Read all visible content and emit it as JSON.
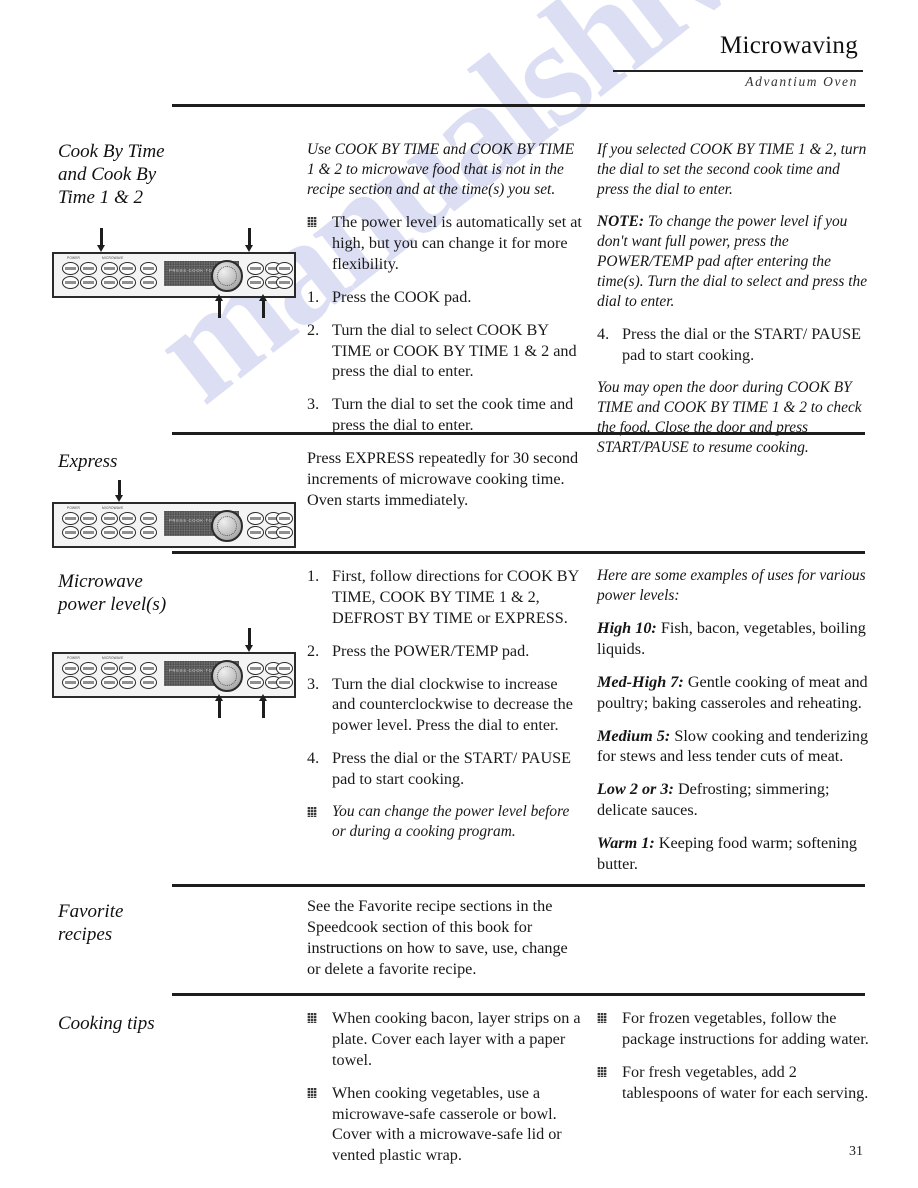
{
  "header": {
    "title": "Microwaving",
    "subtitle": "Advantium Oven"
  },
  "page_number": "31",
  "watermark": "manualshive.com",
  "panel_graphic": {
    "display_text": "PRESS COOK TO START",
    "group_label_left": "POWER",
    "group_label_right": "MICROWAVE"
  },
  "sections": [
    {
      "heading": "Cook By Time and Cook By Time 1 & 2",
      "middle": {
        "intro": "Use COOK BY TIME and COOK BY TIME 1 & 2 to microwave food that is not in the recipe section and at the time(s) you set.",
        "bullet": "The power level is automatically set at high, but you can change it for more flexibility.",
        "steps": [
          {
            "n": "1.",
            "text": "Press the COOK pad."
          },
          {
            "n": "2.",
            "text": "Turn the dial to select COOK BY TIME or COOK BY TIME 1 & 2 and press the dial to enter."
          },
          {
            "n": "3.",
            "text": "Turn the dial to set the cook time and press the dial to enter."
          }
        ]
      },
      "right": {
        "intro": "If you selected COOK BY TIME 1 & 2, turn the dial to set the second cook time and press the dial to enter.",
        "note_label": "NOTE:",
        "note_text": " To change the power level if you don't want full power, press the POWER/TEMP pad after entering the time(s). Turn the dial to select and press the dial to enter.",
        "steps": [
          {
            "n": "4.",
            "text": "Press the dial or the START/ PAUSE pad to start cooking."
          }
        ],
        "closing": "You may open the door during COOK BY TIME and COOK BY TIME 1 & 2 to check the food. Close the door and press START/PAUSE to resume cooking."
      }
    },
    {
      "heading": "Express",
      "middle": {
        "intro": "Press EXPRESS repeatedly for 30 second increments of microwave cooking time. Oven starts immediately."
      }
    },
    {
      "heading": "Microwave power level(s)",
      "middle": {
        "steps": [
          {
            "n": "1.",
            "text": "First, follow directions for COOK BY TIME, COOK BY TIME 1 & 2, DEFROST BY TIME or EXPRESS."
          },
          {
            "n": "2.",
            "text": "Press the POWER/TEMP pad."
          },
          {
            "n": "3.",
            "text": "Turn the dial clockwise to increase and counterclockwise to decrease the power level. Press the dial to enter."
          },
          {
            "n": "4.",
            "text": "Press the dial or the START/ PAUSE pad to start cooking."
          }
        ],
        "bullet": "You can change the power level before or during a cooking program."
      },
      "right": {
        "intro": "Here are some examples of uses for various power levels:",
        "levels": [
          {
            "label": "High 10:",
            "text": " Fish, bacon, vegetables, boiling liquids."
          },
          {
            "label": "Med-High 7:",
            "text": " Gentle cooking of meat and poultry; baking casseroles and reheating."
          },
          {
            "label": "Medium 5:",
            "text": " Slow cooking and tenderizing for stews and less tender cuts of meat."
          },
          {
            "label": "Low 2 or 3:",
            "text": " Defrosting; simmering; delicate sauces."
          },
          {
            "label": "Warm 1:",
            "text": " Keeping food warm; softening butter."
          }
        ]
      }
    },
    {
      "heading": "Favorite recipes",
      "middle": {
        "intro": "See the Favorite recipe sections in the Speedcook section of this book for instructions on how to save, use, change or delete a favorite recipe."
      }
    },
    {
      "heading": "Cooking tips",
      "middle": {
        "tips": [
          "When cooking bacon, layer strips on a plate. Cover each layer with a paper towel.",
          "When cooking vegetables, use a microwave-safe casserole or bowl. Cover with a microwave-safe lid or vented plastic wrap."
        ]
      },
      "right": {
        "tips": [
          "For frozen vegetables, follow the package instructions for adding water.",
          "For fresh vegetables, add 2 tablespoons of water for each serving."
        ]
      }
    }
  ]
}
